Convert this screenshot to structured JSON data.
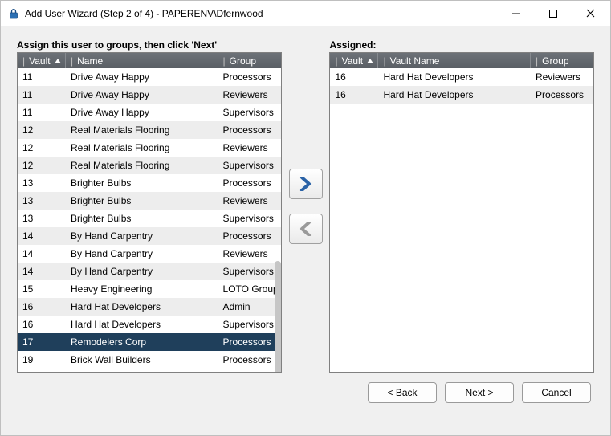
{
  "window": {
    "title": "Add User Wizard (Step 2 of 4) - PAPERENV\\Dfernwood"
  },
  "left": {
    "label": "Assign this user to groups, then click 'Next'",
    "cols": {
      "vault": "Vault",
      "name": "Name",
      "group": "Group"
    },
    "rows": [
      {
        "vault": "11",
        "name": "Drive Away Happy",
        "group": "Processors"
      },
      {
        "vault": "11",
        "name": "Drive Away Happy",
        "group": "Reviewers"
      },
      {
        "vault": "11",
        "name": "Drive Away Happy",
        "group": "Supervisors"
      },
      {
        "vault": "12",
        "name": "Real Materials Flooring",
        "group": "Processors"
      },
      {
        "vault": "12",
        "name": "Real Materials Flooring",
        "group": "Reviewers"
      },
      {
        "vault": "12",
        "name": "Real Materials Flooring",
        "group": "Supervisors"
      },
      {
        "vault": "13",
        "name": "Brighter Bulbs",
        "group": "Processors"
      },
      {
        "vault": "13",
        "name": "Brighter Bulbs",
        "group": "Reviewers"
      },
      {
        "vault": "13",
        "name": "Brighter Bulbs",
        "group": "Supervisors"
      },
      {
        "vault": "14",
        "name": "By Hand Carpentry",
        "group": "Processors"
      },
      {
        "vault": "14",
        "name": "By Hand Carpentry",
        "group": "Reviewers"
      },
      {
        "vault": "14",
        "name": "By Hand Carpentry",
        "group": "Supervisors"
      },
      {
        "vault": "15",
        "name": "Heavy Engineering",
        "group": "LOTO Group"
      },
      {
        "vault": "16",
        "name": "Hard Hat Developers",
        "group": "Admin"
      },
      {
        "vault": "16",
        "name": "Hard Hat Developers",
        "group": "Supervisors"
      },
      {
        "vault": "17",
        "name": "Remodelers Corp",
        "group": "Processors"
      },
      {
        "vault": "19",
        "name": "Brick Wall Builders",
        "group": "Processors"
      }
    ],
    "selected_index": 15
  },
  "right": {
    "label": "Assigned:",
    "cols": {
      "vault": "Vault",
      "name": "Vault Name",
      "group": "Group"
    },
    "rows": [
      {
        "vault": "16",
        "name": "Hard Hat Developers",
        "group": "Reviewers"
      },
      {
        "vault": "16",
        "name": "Hard Hat Developers",
        "group": "Processors"
      }
    ]
  },
  "buttons": {
    "back": "< Back",
    "next": "Next >",
    "cancel": "Cancel"
  }
}
